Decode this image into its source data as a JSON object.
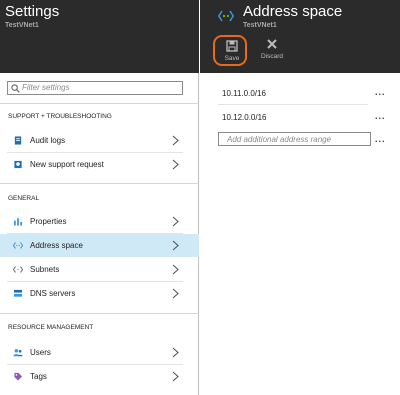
{
  "settings": {
    "title": "Settings",
    "subtitle": "TestVNet1",
    "filter_placeholder": "Filter settings",
    "sections": [
      {
        "heading": "SUPPORT + TROUBLESHOOTING",
        "items": [
          {
            "label": "Audit logs",
            "icon": "audit-log-icon"
          },
          {
            "label": "New support request",
            "icon": "support-request-icon"
          }
        ]
      },
      {
        "heading": "GENERAL",
        "items": [
          {
            "label": "Properties",
            "icon": "properties-icon"
          },
          {
            "label": "Address space",
            "icon": "address-space-icon",
            "selected": true
          },
          {
            "label": "Subnets",
            "icon": "subnets-icon"
          },
          {
            "label": "DNS servers",
            "icon": "dns-servers-icon"
          }
        ]
      },
      {
        "heading": "RESOURCE MANAGEMENT",
        "items": [
          {
            "label": "Users",
            "icon": "users-icon"
          },
          {
            "label": "Tags",
            "icon": "tags-icon"
          }
        ]
      }
    ]
  },
  "address_blade": {
    "title": "Address space",
    "subtitle": "TestVNet1",
    "toolbar": {
      "save_label": "Save",
      "discard_label": "Discard"
    },
    "address_ranges": [
      "10.11.0.0/16",
      "10.12.0.0/16"
    ],
    "more_label": "...",
    "new_range_placeholder": "Add additional address range"
  },
  "colors": {
    "header_bg": "#2b2b2b",
    "selected_row": "#cfe9f6",
    "save_highlight": "#e66a17",
    "accent_blue": "#3a96dd"
  }
}
